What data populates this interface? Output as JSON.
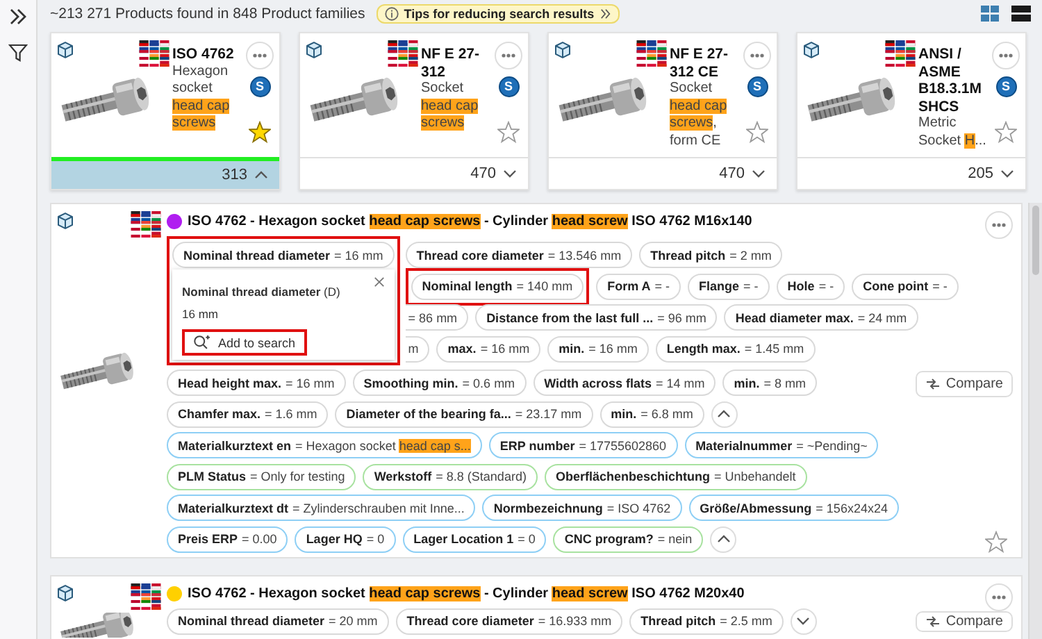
{
  "summary": "~213 271 Products found in 848 Product families",
  "tips": {
    "label": "Tips for reducing search results"
  },
  "view_modes": [
    {
      "kind": "grid",
      "selected": false
    },
    {
      "kind": "list",
      "selected": true
    }
  ],
  "families": [
    {
      "title": "ISO 4762",
      "subtitle": [
        {
          "text": "Hexagon socket ",
          "highlight": false
        },
        {
          "text": "head cap screws",
          "highlight": true
        }
      ],
      "badge": "S",
      "favorite": true,
      "selected": true,
      "expanded": true,
      "count": "313"
    },
    {
      "title": "NF E 27-312",
      "subtitle": [
        {
          "text": "Socket ",
          "highlight": false
        },
        {
          "text": "head cap screws",
          "highlight": true
        }
      ],
      "badge": "S",
      "favorite": false,
      "selected": false,
      "expanded": false,
      "count": "470"
    },
    {
      "title": "NF E 27-312 CE",
      "subtitle": [
        {
          "text": "Socket ",
          "highlight": false
        },
        {
          "text": "head cap screws",
          "highlight": true
        },
        {
          "text": ", form CE",
          "highlight": false
        }
      ],
      "badge": "S",
      "favorite": false,
      "selected": false,
      "expanded": false,
      "count": "470"
    },
    {
      "title": "ANSI / ASME B18.3.1M SHCS",
      "subtitle": [
        {
          "text": "Metric Socket ",
          "highlight": false
        },
        {
          "text": "H",
          "highlight": true
        },
        {
          "text": "...",
          "highlight": false
        }
      ],
      "badge": "S",
      "favorite": false,
      "selected": false,
      "expanded": false,
      "count": "205"
    }
  ],
  "results": [
    {
      "color": "#b01ef0",
      "title": [
        {
          "text": "ISO 4762 - Hexagon socket ",
          "highlight": false
        },
        {
          "text": "head cap screws",
          "highlight": true
        },
        {
          "text": " - Cylinder ",
          "highlight": false
        },
        {
          "text": "head screw",
          "highlight": true
        },
        {
          "text": " ISO 4762 M16x140",
          "highlight": false
        }
      ],
      "favorite": false,
      "compare": "Compare",
      "popup": {
        "chip": {
          "label": "Nominal thread diameter",
          "value": "= 16 mm",
          "color": "#d9d9d9",
          "outlined": false
        },
        "title": "**Nominal thread diameter** (D)",
        "value": "16 mm",
        "button": "Add to search",
        "outlined": true,
        "button_outlined": true
      },
      "side_rows": [
        {
          "chips": [
            {
              "label": "Thread core diameter",
              "value": "= 13.546 mm",
              "color": "#d9d9d9",
              "outlined": false
            },
            {
              "label": "Thread pitch",
              "value": "= 2 mm",
              "color": "#d9d9d9",
              "outlined": false
            }
          ]
        },
        {
          "chips": [
            {
              "label": "Nominal length",
              "value": "= 140 mm",
              "color": "#d9d9d9",
              "outlined": true
            },
            {
              "label": "Form A",
              "value": "= -",
              "color": "#d9d9d9",
              "outlined": false
            },
            {
              "label": "Flange",
              "value": "= -",
              "color": "#d9d9d9",
              "outlined": false
            },
            {
              "label": "Hole",
              "value": "= -",
              "color": "#d9d9d9",
              "outlined": false
            },
            {
              "label": "Cone point",
              "value": "= -",
              "color": "#d9d9d9",
              "outlined": false
            }
          ]
        },
        {
          "chips": [
            {
              "value": "= 86 mm",
              "color": "#d9d9d9",
              "outlined": false
            },
            {
              "label": "Distance from the last full ...",
              "value": "= 96 mm",
              "color": "#d9d9d9",
              "outlined": false
            },
            {
              "label": "Head diameter max.",
              "value": "= 24 mm",
              "color": "#d9d9d9",
              "outlined": false
            }
          ]
        },
        {
          "chips": [
            {
              "value": "m",
              "color": "#d9d9d9",
              "outlined": false
            },
            {
              "label": "max.",
              "value": "= 16 mm",
              "color": "#d9d9d9",
              "outlined": false
            },
            {
              "label": "min.",
              "value": "= 16 mm",
              "color": "#d9d9d9",
              "outlined": false
            },
            {
              "label": "Length max.",
              "value": "= 1.45 mm",
              "color": "#d9d9d9",
              "outlined": false
            }
          ]
        }
      ],
      "rows": [
        {
          "chips": [
            {
              "label": "Head height max.",
              "value": "= 16 mm",
              "color": "#d9d9d9",
              "outlined": false
            },
            {
              "label": "Smoothing min.",
              "value": "= 0.6 mm",
              "color": "#d9d9d9",
              "outlined": false
            },
            {
              "label": "Width across flats",
              "value": "= 14 mm",
              "color": "#d9d9d9",
              "outlined": false
            },
            {
              "label": "min.",
              "value": "= 8 mm",
              "color": "#d9d9d9",
              "outlined": false
            }
          ]
        },
        {
          "chips": [
            {
              "label": "Chamfer max.",
              "value": "= 1.6 mm",
              "color": "#d9d9d9",
              "outlined": false
            },
            {
              "label": "Diameter of the bearing fa...",
              "value": "= 23.17 mm",
              "color": "#d9d9d9",
              "outlined": false
            },
            {
              "label": "min.",
              "value": "= 6.8 mm",
              "color": "#d9d9d9",
              "outlined": false
            }
          ],
          "expanded": true
        },
        {
          "chips": [
            {
              "label": "Materialkurztext en",
              "value": [
                {
                  "text": "= Hexagon socket ",
                  "highlight": false
                },
                {
                  "text": "head cap s...",
                  "highlight": true
                }
              ],
              "color": "#8ecff5",
              "outlined": false
            },
            {
              "label": "ERP number",
              "value": "= 17755602860",
              "color": "#8ecff5",
              "outlined": false
            },
            {
              "label": "Materialnummer",
              "value": "= ~Pending~",
              "color": "#8ecff5",
              "outlined": false
            }
          ]
        },
        {
          "chips": [
            {
              "label": "PLM Status",
              "value": "= Only for testing",
              "color": "#a8e2a0",
              "outlined": false
            },
            {
              "label": "Werkstoff",
              "value": "= 8.8 (Standard)",
              "color": "#a8e2a0",
              "outlined": false
            },
            {
              "label": "Oberflächenbeschichtung",
              "value": "= Unbehandelt",
              "color": "#a8e2a0",
              "outlined": false
            }
          ]
        },
        {
          "chips": [
            {
              "label": "Materialkurztext dt",
              "value": "= Zylinderschrauben mit Inne...",
              "color": "#8ecff5",
              "outlined": false
            },
            {
              "label": "Normbezeichnung",
              "value": "= ISO 4762",
              "color": "#8ecff5",
              "outlined": false
            },
            {
              "label": "Größe/Abmessung",
              "value": "= 156x24x24",
              "color": "#8ecff5",
              "outlined": false
            }
          ]
        },
        {
          "chips": [
            {
              "label": "Preis ERP",
              "value": "= 0.00",
              "color": "#8ecff5",
              "outlined": false
            },
            {
              "label": "Lager HQ",
              "value": "= 0",
              "color": "#8ecff5",
              "outlined": false
            },
            {
              "label": "Lager Location 1",
              "value": "= 0",
              "color": "#8ecff5",
              "outlined": false
            },
            {
              "label": "CNC program?",
              "value": "= nein",
              "color": "#a8e2a0",
              "outlined": false
            }
          ],
          "expanded": true
        }
      ]
    },
    {
      "color": "#ffd000",
      "title": [
        {
          "text": "ISO 4762 - Hexagon socket ",
          "highlight": false
        },
        {
          "text": "head cap screws",
          "highlight": true
        },
        {
          "text": " - Cylinder ",
          "highlight": false
        },
        {
          "text": "head screw",
          "highlight": true
        },
        {
          "text": " ISO 4762 M20x40",
          "highlight": false
        }
      ],
      "compare": "Compare",
      "rows": [
        {
          "chips": [
            {
              "label": "Nominal thread diameter",
              "value": "= 20 mm",
              "color": "#d9d9d9",
              "outlined": false
            },
            {
              "label": "Thread core diameter",
              "value": "= 16.933 mm",
              "color": "#d9d9d9",
              "outlined": false
            },
            {
              "label": "Thread pitch",
              "value": "= 2.5 mm",
              "color": "#d9d9d9",
              "outlined": false
            }
          ],
          "expanded": false
        }
      ]
    }
  ]
}
